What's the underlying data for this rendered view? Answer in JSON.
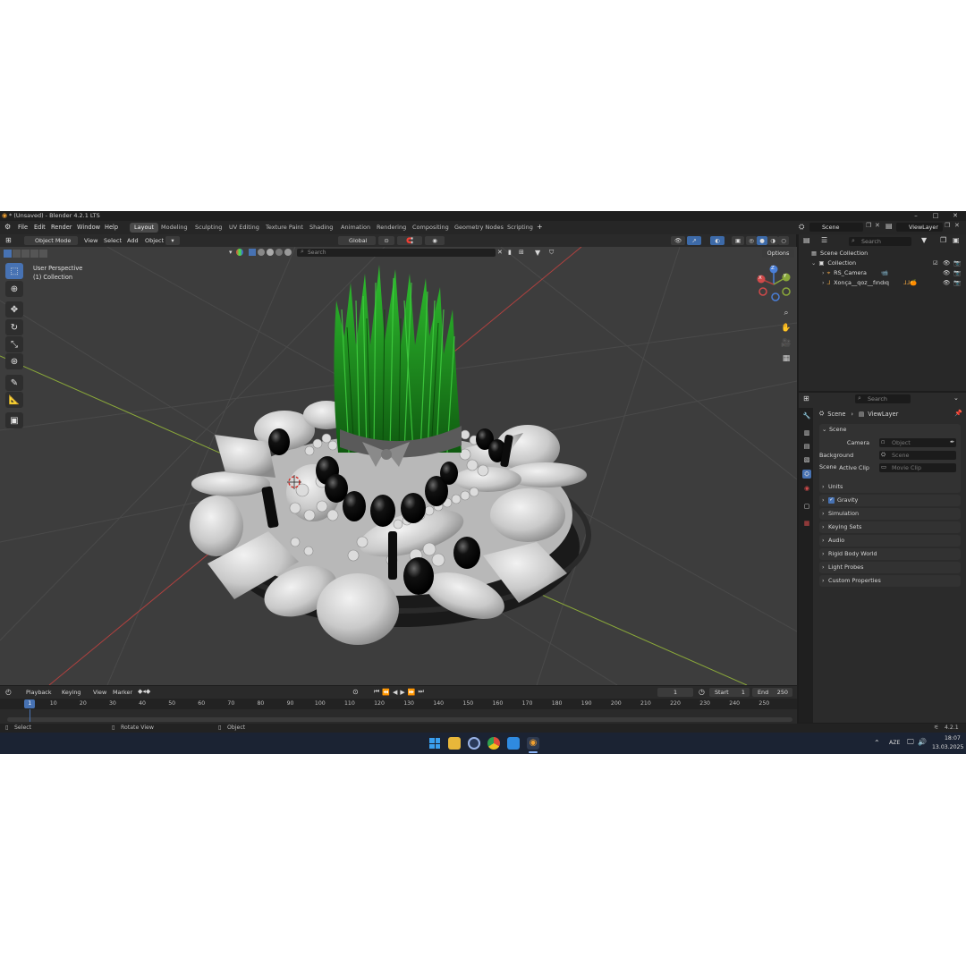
{
  "window": {
    "title": "* (Unsaved) - Blender 4.2.1 LTS",
    "controls": [
      "–",
      "□",
      "✕"
    ]
  },
  "menu": [
    "File",
    "Edit",
    "Render",
    "Window",
    "Help"
  ],
  "workspaces": [
    "Layout",
    "Modeling",
    "Sculpting",
    "UV Editing",
    "Texture Paint",
    "Shading",
    "Animation",
    "Rendering",
    "Compositing",
    "Geometry Nodes",
    "Scripting"
  ],
  "active_workspace": "Layout",
  "scene_selector": {
    "scene": "Scene",
    "view_layer": "ViewLayer"
  },
  "viewport_header": {
    "mode": "Object Mode",
    "menus": [
      "View",
      "Select",
      "Add",
      "Object"
    ],
    "transform_orientation": "Global",
    "search_placeholder": "Search",
    "options": "Options"
  },
  "viewport_overlay_text": {
    "perspective": "User Perspective",
    "collection": "(1) Collection"
  },
  "gizmo_axes": {
    "x": "X",
    "y": "Y",
    "z": "Z"
  },
  "outliner": {
    "search_placeholder": "Search",
    "rows": [
      {
        "label": "Scene Collection"
      },
      {
        "label": "Collection"
      },
      {
        "label": "RS_Camera"
      },
      {
        "label": "Xonça__qoz__fındıq"
      }
    ]
  },
  "properties": {
    "search_placeholder": "Search",
    "breadcrumb": [
      "Scene",
      "ViewLayer"
    ],
    "scene_panel": {
      "title": "Scene",
      "fields": [
        {
          "label": "Camera",
          "placeholder": "Object"
        },
        {
          "label": "Background Scene",
          "placeholder": "Scene"
        },
        {
          "label": "Active Clip",
          "placeholder": "Movie Clip"
        }
      ]
    },
    "panels": [
      "Units",
      "Gravity",
      "Simulation",
      "Keying Sets",
      "Audio",
      "Rigid Body World",
      "Light Probes",
      "Custom Properties"
    ],
    "gravity_checked": true
  },
  "timeline": {
    "menus": [
      "Playback",
      "Keying",
      "View",
      "Marker"
    ],
    "current_frame": "1",
    "start_label": "Start",
    "start_value": "1",
    "end_label": "End",
    "end_value": "250",
    "ruler": [
      "1",
      "10",
      "20",
      "30",
      "40",
      "50",
      "60",
      "70",
      "80",
      "90",
      "100",
      "110",
      "120",
      "130",
      "140",
      "150",
      "160",
      "170",
      "180",
      "190",
      "200",
      "210",
      "220",
      "230",
      "240",
      "250"
    ]
  },
  "statusbar": {
    "hints": [
      "Select",
      "Rotate View",
      "Object"
    ],
    "version": "4.2.1"
  },
  "taskbar": {
    "language": "AZE",
    "time": "18:07",
    "date": "13.03.2025"
  },
  "colors": {
    "accent": "#4772b3",
    "grass": "#1f8f1f",
    "axis_x": "#b0413f",
    "axis_y": "#8aa83a"
  }
}
